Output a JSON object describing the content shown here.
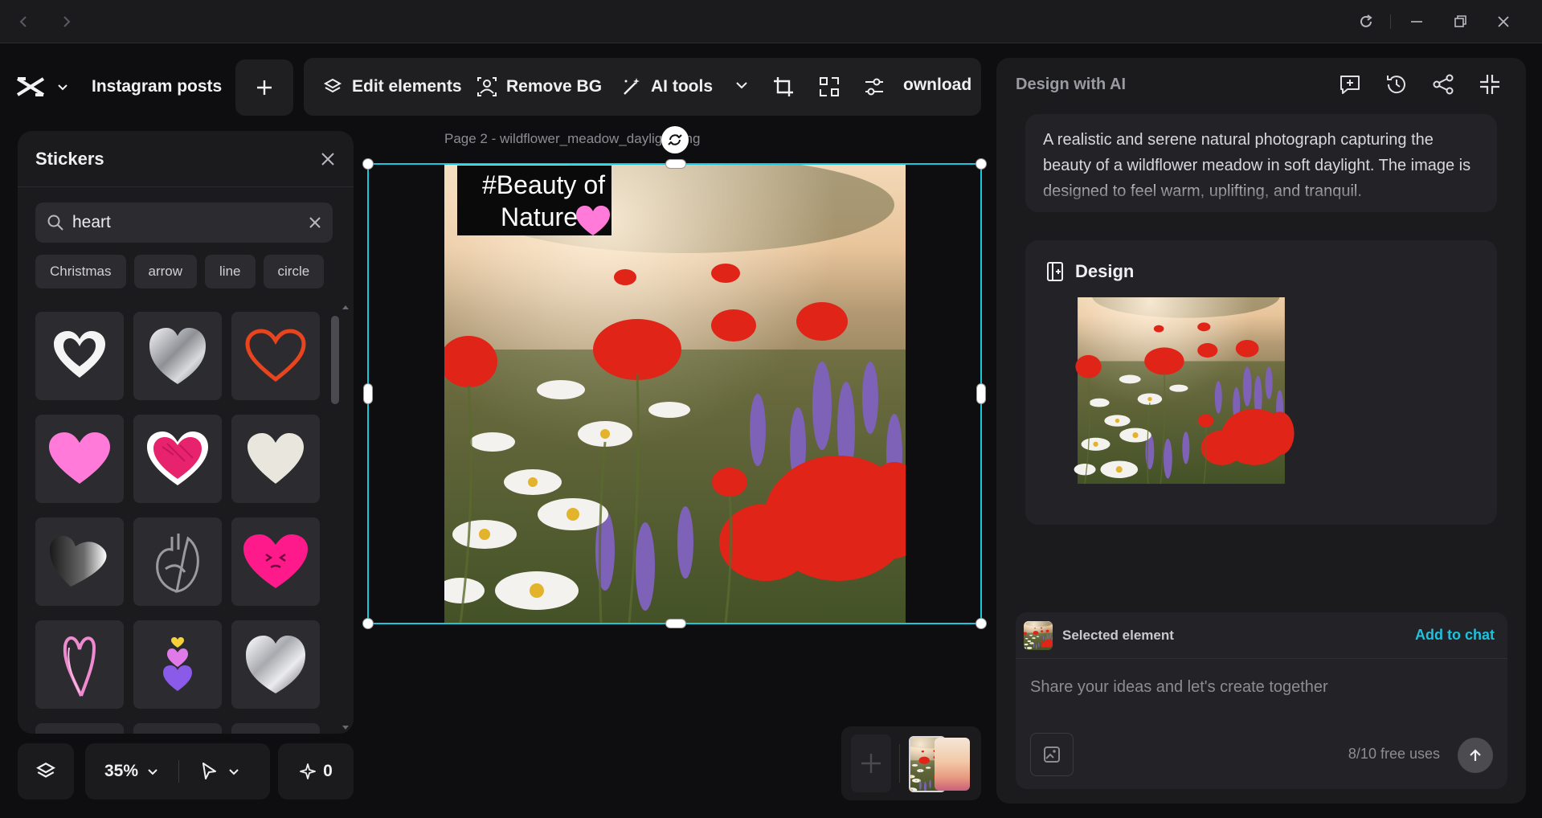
{
  "window": {
    "controls": [
      "back-icon",
      "forward-icon",
      "reload-icon",
      "minimize-icon",
      "maximize-icon",
      "close-icon"
    ]
  },
  "toolbar": {
    "project_title": "Instagram posts",
    "edit_elements": "Edit elements",
    "remove_bg": "Remove BG",
    "ai_tools": "AI tools",
    "download": "ownload"
  },
  "stickers": {
    "title": "Stickers",
    "search_value": "heart",
    "chips": [
      "Christmas",
      "arrow",
      "line",
      "circle"
    ],
    "items": [
      "white-outline-heart",
      "chrome-heart",
      "orange-outline-heart",
      "pink-heart",
      "sketch-pink-heart",
      "white-heart",
      "black-gradient-heart",
      "anatomical-heart",
      "hot-pink-face-heart",
      "pink-doodle-heart",
      "stacked-hearts",
      "chrome-heart-2"
    ]
  },
  "bottom_controls": {
    "zoom": "35%",
    "counter": "0"
  },
  "canvas": {
    "page_label": "Page 2 -  wildflower_meadow_daylight.png",
    "headline_line1": "#Beauty of",
    "headline_line2": "Nature"
  },
  "ai_panel": {
    "title": "Design with AI",
    "description": "A realistic and serene natural photograph capturing the beauty of a wildflower meadow in soft daylight. The image is designed to feel warm, uplifting, and tranquil.",
    "design_label": "Design",
    "selected_element": "Selected element",
    "add_to_chat": "Add to chat",
    "chat_placeholder": "Share your ideas and let's create together",
    "free_uses": "8/10 free uses"
  },
  "colors": {
    "accent": "#19c6dc",
    "background": "#0e0e10",
    "panel": "#1b1b1e",
    "poppy": "#e02418"
  }
}
